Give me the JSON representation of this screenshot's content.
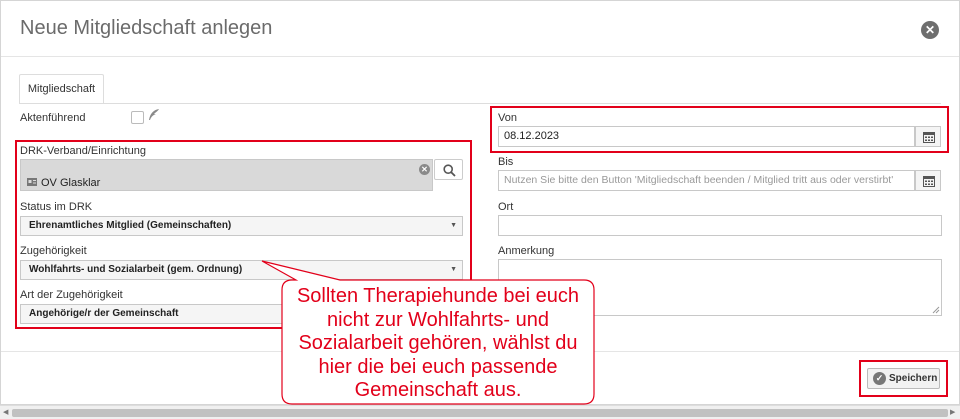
{
  "dialog": {
    "title": "Neue Mitgliedschaft anlegen",
    "close_icon": "close-icon"
  },
  "tabs": [
    {
      "label": "Mitgliedschaft",
      "active": true
    }
  ],
  "form": {
    "aktenfuehrend_label": "Aktenführend",
    "drk_label": "DRK-Verband/Einrichtung",
    "drk_value": "OV Glasklar",
    "status_label": "Status im DRK",
    "status_value": "Ehrenamtliches Mitglied (Gemeinschaften)",
    "zugehoerigkeit_label": "Zugehörigkeit",
    "zugehoerigkeit_value": "Wohlfahrts- und Sozialarbeit (gem. Ordnung)",
    "art_label": "Art der Zugehörigkeit",
    "art_value": "Angehörige/r der Gemeinschaft",
    "von_label": "Von",
    "von_value": "08.12.2023",
    "bis_label": "Bis",
    "bis_placeholder": "Nutzen Sie bitte den Button 'Mitgliedschaft beenden / Mitglied tritt aus oder verstirbt'",
    "ort_label": "Ort",
    "ort_value": "",
    "anmerkung_label": "Anmerkung",
    "anmerkung_value": ""
  },
  "footer": {
    "save_label": "Speichern"
  },
  "callout": {
    "text": "Sollten Therapiehunde bei euch nicht zur Wohlfahrts- und Sozialarbeit gehören, wählst du hier die bei euch passende Gemeinschaft aus.",
    "color": "#e2001a"
  },
  "colors": {
    "highlight": "#e2001a"
  }
}
